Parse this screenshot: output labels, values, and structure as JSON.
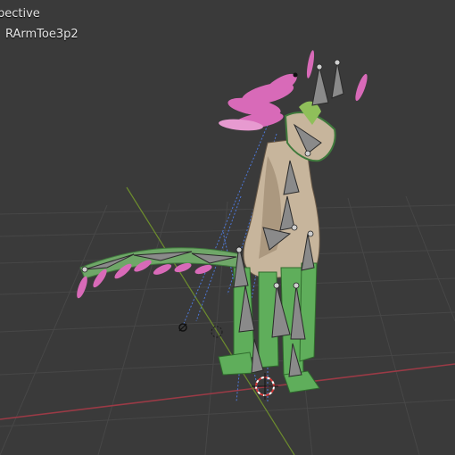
{
  "viewport": {
    "view_label": "pective",
    "object_label": "RArmToe3p2"
  },
  "colors": {
    "background": "#3a3a3a",
    "grid": "#454545",
    "axis_x": "#9b3a46",
    "axis_y": "#6d8d2d",
    "mesh_body": "#c7b59c",
    "mesh_green": "#5fae5b",
    "feathers": "#d86ab8",
    "bones": "#8a8a8a",
    "constraint_lines": "#4d78d8",
    "cursor": "#d33a3a"
  },
  "icons": [
    "3d-cursor-icon",
    "light-icon",
    "camera-icon"
  ]
}
